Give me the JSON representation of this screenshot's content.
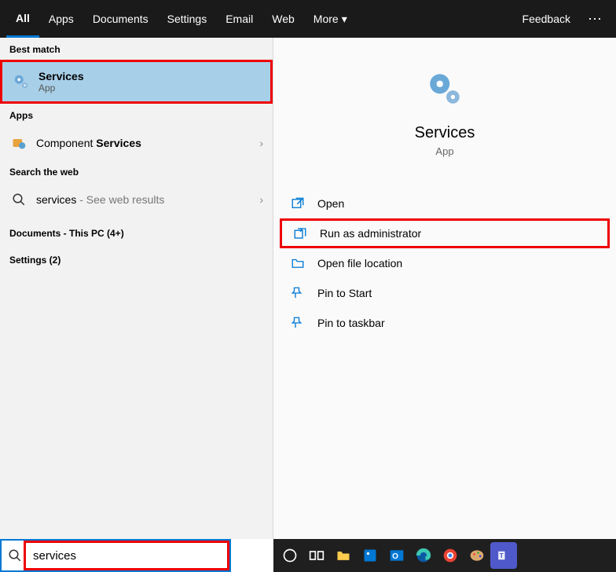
{
  "tabs": {
    "items": [
      "All",
      "Apps",
      "Documents",
      "Settings",
      "Email",
      "Web",
      "More"
    ],
    "feedback": "Feedback"
  },
  "left": {
    "best_match_label": "Best match",
    "best_match": {
      "title": "Services",
      "sub": "App"
    },
    "apps_label": "Apps",
    "apps_item": {
      "prefix": "Component ",
      "bold": "Services"
    },
    "web_label": "Search the web",
    "web_item": {
      "prefix": "services",
      "suffix": " - See web results"
    },
    "docs_label": "Documents - This PC (4+)",
    "settings_label": "Settings (2)"
  },
  "preview": {
    "title": "Services",
    "sub": "App"
  },
  "actions": {
    "open": "Open",
    "run_admin": "Run as administrator",
    "open_loc": "Open file location",
    "pin_start": "Pin to Start",
    "pin_taskbar": "Pin to taskbar"
  },
  "search": {
    "value": "services"
  }
}
